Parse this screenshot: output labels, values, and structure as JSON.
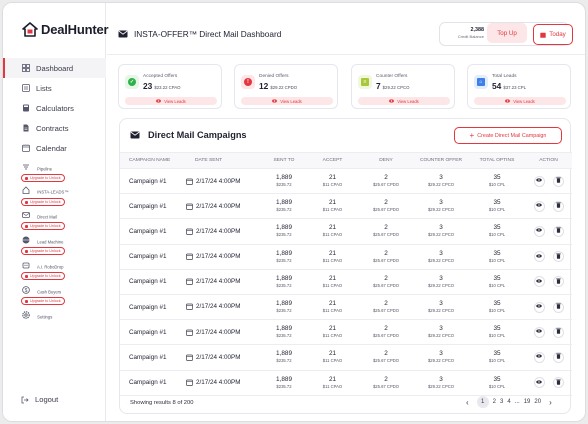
{
  "app": {
    "logo_text": "DealHunter"
  },
  "sidebar": {
    "items": [
      {
        "label": "Dashboard",
        "icon": "grid-icon"
      },
      {
        "label": "Lists",
        "icon": "list-icon"
      },
      {
        "label": "Calculators",
        "icon": "calculator-icon"
      },
      {
        "label": "Contracts",
        "icon": "document-icon"
      },
      {
        "label": "Calendar",
        "icon": "calendar-icon"
      },
      {
        "label": "Pipeline",
        "icon": "filter-icon"
      },
      {
        "label": "INSTA-LEADS™",
        "icon": "home-icon"
      },
      {
        "label": "Direct Mail",
        "icon": "mail-icon"
      },
      {
        "label": "Lead Machine",
        "icon": "globe-icon"
      },
      {
        "label": "A.I. RoboDrop",
        "icon": "robot-icon"
      },
      {
        "label": "Cash Buyers",
        "icon": "dollar-icon"
      },
      {
        "label": "Settings",
        "icon": "gear-icon"
      }
    ],
    "upgrade_label": "Upgrade to Unlock",
    "logout_label": "Logout"
  },
  "header": {
    "title": "INSTA-OFFER™ Direct Mail Dashboard",
    "credit_value": "2,388",
    "credit_label": "Credit Balance",
    "topup_label": "Top Up",
    "today_label": "Today"
  },
  "stats": [
    {
      "label": "Accepted Offers",
      "value": "23",
      "sub": "$23.22 CPAO",
      "button": "View Leads",
      "color": "#2fb14a",
      "bg": "#e6f6e9",
      "icon": "check-icon"
    },
    {
      "label": "Denied Offers",
      "value": "12",
      "sub": "$29.22 CPDO",
      "button": "View Leads",
      "color": "#e2373f",
      "bg": "#fde6e7",
      "icon": "alert-icon"
    },
    {
      "label": "Counter Offers",
      "value": "7",
      "sub": "$29.22 CPCO",
      "button": "View Leads",
      "color": "#a8c83a",
      "bg": "#f1f7dc",
      "icon": "document-icon"
    },
    {
      "label": "Total Leads",
      "value": "54",
      "sub": "$37.23 CPL",
      "button": "View Leads",
      "color": "#3f7fe8",
      "bg": "#e4edfc",
      "icon": "home-icon"
    }
  ],
  "campaigns": {
    "title": "Direct Mail Campaigns",
    "create_label": "Create Direct Mail Campaign",
    "columns": [
      "CAMPAIGN NAME",
      "DATE SENT",
      "SENT TO",
      "ACCEPT",
      "DENY",
      "COUNTER OFFER",
      "TOTAL OPTINS",
      "ACTION"
    ],
    "rows": [
      {
        "name": "Campaign #1",
        "date": "2/17/24 4:00PM",
        "sent": "1,889",
        "sent_sub": "$235.72",
        "accept": "21",
        "accept_sub": "$11 CPAO",
        "deny": "2",
        "deny_sub": "$25.67 CPDO",
        "counter": "3",
        "counter_sub": "$29.22 CPCO",
        "optins": "35",
        "optins_sub": "$10 CPL"
      },
      {
        "name": "Campaign #1",
        "date": "2/17/24 4:00PM",
        "sent": "1,889",
        "sent_sub": "$235.72",
        "accept": "21",
        "accept_sub": "$11 CPAO",
        "deny": "2",
        "deny_sub": "$25.67 CPDO",
        "counter": "3",
        "counter_sub": "$29.22 CPCO",
        "optins": "35",
        "optins_sub": "$10 CPL"
      },
      {
        "name": "Campaign #1",
        "date": "2/17/24 4:00PM",
        "sent": "1,889",
        "sent_sub": "$235.72",
        "accept": "21",
        "accept_sub": "$11 CPAO",
        "deny": "2",
        "deny_sub": "$25.67 CPDO",
        "counter": "3",
        "counter_sub": "$29.22 CPCO",
        "optins": "35",
        "optins_sub": "$10 CPL"
      },
      {
        "name": "Campaign #1",
        "date": "2/17/24 4:00PM",
        "sent": "1,889",
        "sent_sub": "$235.72",
        "accept": "21",
        "accept_sub": "$11 CPAO",
        "deny": "2",
        "deny_sub": "$25.67 CPDO",
        "counter": "3",
        "counter_sub": "$29.22 CPCO",
        "optins": "35",
        "optins_sub": "$10 CPL"
      },
      {
        "name": "Campaign #1",
        "date": "2/17/24 4:00PM",
        "sent": "1,889",
        "sent_sub": "$235.72",
        "accept": "21",
        "accept_sub": "$11 CPAO",
        "deny": "2",
        "deny_sub": "$25.67 CPDO",
        "counter": "3",
        "counter_sub": "$29.22 CPCO",
        "optins": "35",
        "optins_sub": "$10 CPL"
      },
      {
        "name": "Campaign #1",
        "date": "2/17/24 4:00PM",
        "sent": "1,889",
        "sent_sub": "$235.72",
        "accept": "21",
        "accept_sub": "$11 CPAO",
        "deny": "2",
        "deny_sub": "$25.67 CPDO",
        "counter": "3",
        "counter_sub": "$29.22 CPCO",
        "optins": "35",
        "optins_sub": "$10 CPL"
      },
      {
        "name": "Campaign #1",
        "date": "2/17/24 4:00PM",
        "sent": "1,889",
        "sent_sub": "$235.72",
        "accept": "21",
        "accept_sub": "$11 CPAO",
        "deny": "2",
        "deny_sub": "$25.67 CPDO",
        "counter": "3",
        "counter_sub": "$29.22 CPCO",
        "optins": "35",
        "optins_sub": "$10 CPL"
      },
      {
        "name": "Campaign #1",
        "date": "2/17/24 4:00PM",
        "sent": "1,889",
        "sent_sub": "$235.72",
        "accept": "21",
        "accept_sub": "$11 CPAO",
        "deny": "2",
        "deny_sub": "$25.67 CPDO",
        "counter": "3",
        "counter_sub": "$29.22 CPCO",
        "optins": "35",
        "optins_sub": "$10 CPL"
      },
      {
        "name": "Campaign #1",
        "date": "2/17/24 4:00PM",
        "sent": "1,889",
        "sent_sub": "$235.72",
        "accept": "21",
        "accept_sub": "$11 CPAO",
        "deny": "2",
        "deny_sub": "$25.67 CPDO",
        "counter": "3",
        "counter_sub": "$29.22 CPCO",
        "optins": "35",
        "optins_sub": "$10 CPL"
      }
    ],
    "footer_text": "Showing results 8 of 200",
    "pages": [
      "1",
      "2",
      "3",
      "4",
      "...",
      "19",
      "20"
    ]
  },
  "colors": {
    "accent": "#e2373f",
    "accent_light": "#fde6e7"
  }
}
